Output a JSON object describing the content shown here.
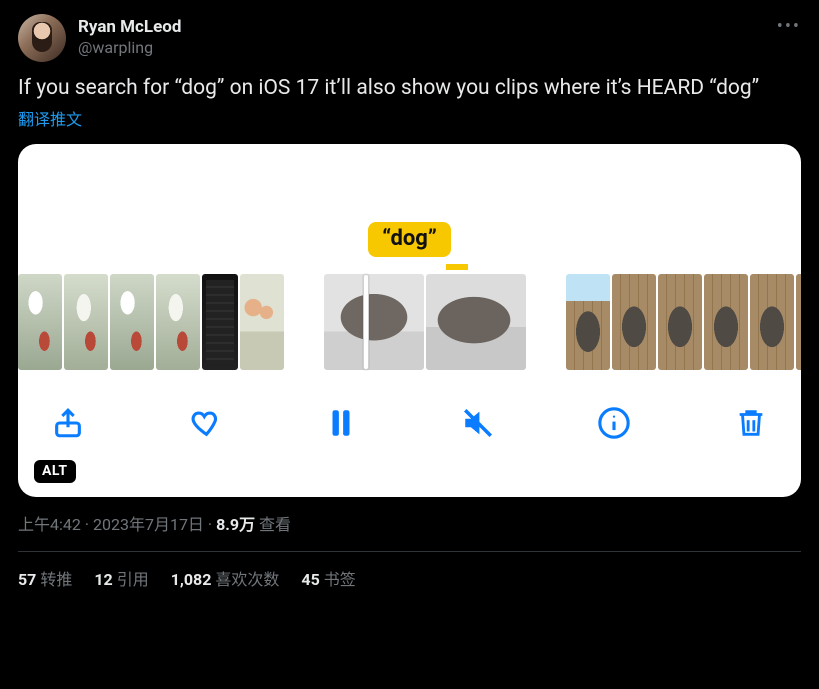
{
  "user": {
    "display_name": "Ryan McLeod",
    "handle": "@warpling"
  },
  "body": "If you search for “dog” on iOS 17 it’ll also show you clips where it’s HEARD “dog”",
  "translate": "翻译推文",
  "card": {
    "search_term": "“dog”",
    "alt_badge": "ALT"
  },
  "meta": {
    "time": "上午4:42",
    "sep1": " · ",
    "date": "2023年7月17日",
    "sep2": " · ",
    "views_number": "8.9万",
    "views_label": " 查看"
  },
  "stats": {
    "retweets_n": "57",
    "retweets_l": "转推",
    "quotes_n": "12",
    "quotes_l": "引用",
    "likes_n": "1,082",
    "likes_l": "喜欢次数",
    "bookmarks_n": "45",
    "bookmarks_l": "书签"
  }
}
